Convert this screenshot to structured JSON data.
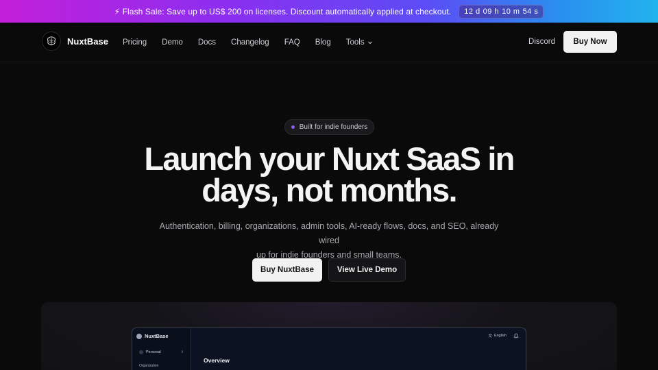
{
  "banner": {
    "icon": "lightning-icon",
    "message": "⚡ Flash Sale: Save up to US$ 200 on licenses. Discount automatically applied at checkout.",
    "countdown": {
      "days": "12 d",
      "hours": "09 h",
      "minutes": "10 m",
      "seconds": "54 s"
    }
  },
  "nav": {
    "brand": "NuxtBase",
    "logo_icon": "brain-logo-icon",
    "links": [
      "Pricing",
      "Demo",
      "Docs",
      "Changelog",
      "FAQ",
      "Blog",
      "Tools"
    ],
    "discord": "Discord",
    "buy_now": "Buy Now"
  },
  "hero": {
    "badge": "Built for indie founders",
    "headline_line1": "Launch your Nuxt SaaS in",
    "headline_line2": "days, not months.",
    "subtitle_line1": "Authentication, billing, organizations, admin tools, AI-ready flows, docs, and SEO, already wired",
    "subtitle_line2": "up for indie founders and small teams.",
    "cta_primary": "Buy NuxtBase",
    "cta_secondary": "View Live Demo"
  },
  "preview": {
    "brand": "NuxtBase",
    "workspace": "Personal",
    "section_label": "Organization",
    "language": "English",
    "page_title": "Overview"
  },
  "colors": {
    "background": "#0a0a0b",
    "banner_start": "#c21fd9",
    "banner_end": "#22b3ec",
    "badge_dot": "#8b5cf6",
    "button_light": "#f2f2f3"
  }
}
